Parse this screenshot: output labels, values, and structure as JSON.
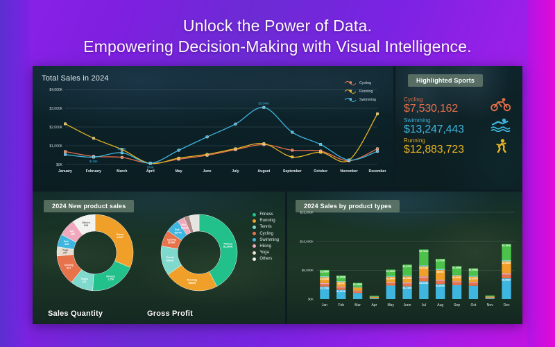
{
  "headline": {
    "line1": "Unlock the Power of Data.",
    "line2": "Empowering Decision-Making with Visual Intelligence."
  },
  "colors": {
    "cycling": "#e8724a",
    "running": "#e8b324",
    "swimming": "#3fb6e0",
    "fitness": "#22c08a",
    "tennis": "#7fd9cd",
    "hiking": "#f0a8bd",
    "yoga": "#e8ded0",
    "others": "#f2f2f0",
    "panel_bg": "#0c1c22",
    "chip_bg": "#7c927c"
  },
  "line_panel": {
    "title": "Total Sales in 2024",
    "chart_data": {
      "type": "line",
      "title": "Total Sales in 2024",
      "xlabel": "",
      "ylabel": "",
      "ylim": [
        0,
        4000
      ],
      "yticks": [
        "$0K",
        "$1,000K",
        "$2,000K",
        "$3,000K",
        "$4,000K"
      ],
      "grid": true,
      "legend_position": "right",
      "categories": [
        "January",
        "February",
        "March",
        "April",
        "May",
        "June",
        "July",
        "August",
        "September",
        "October",
        "November",
        "December"
      ],
      "series": [
        {
          "name": "Cycling",
          "color": "#e8724a",
          "values": [
            690,
            430,
            380,
            60,
            280,
            490,
            790,
            1060,
            760,
            720,
            200,
            840
          ]
        },
        {
          "name": "Running",
          "color": "#e8b324",
          "values": [
            2170,
            1400,
            800,
            60,
            340,
            540,
            840,
            1110,
            400,
            650,
            230,
            2700
          ]
        },
        {
          "name": "Swimming",
          "color": "#3fb6e0",
          "values": [
            530,
            390,
            620,
            70,
            760,
            1470,
            2160,
            3044,
            1720,
            1070,
            240,
            700
          ]
        }
      ],
      "point_labels": [
        {
          "series": "Swimming",
          "category": "February",
          "text": "$135K"
        },
        {
          "series": "Swimming",
          "category": "March",
          "text": "$650K"
        },
        {
          "series": "Swimming",
          "category": "April",
          "text": "$70K"
        },
        {
          "series": "Swimming",
          "category": "August",
          "text": "$3,044K"
        }
      ]
    }
  },
  "sports_panel": {
    "header": "Highlighted Sports",
    "items": [
      {
        "name": "Cycling",
        "value": "$7,530,162",
        "color": "#e8724a",
        "icon": "cycling-icon"
      },
      {
        "name": "Swimming",
        "value": "$13,247,443",
        "color": "#3fb6e0",
        "icon": "swimming-icon"
      },
      {
        "name": "Running",
        "value": "$12,883,723",
        "color": "#e8b324",
        "icon": "running-icon"
      }
    ]
  },
  "donut_panel": {
    "header": "2024 New product sales",
    "legend": [
      {
        "label": "Fitness",
        "color": "#22c08a"
      },
      {
        "label": "Running",
        "color": "#f0a028"
      },
      {
        "label": "Tennis",
        "color": "#7fd9cd"
      },
      {
        "label": "Cycling",
        "color": "#e8724a"
      },
      {
        "label": "Swimming",
        "color": "#3fb6e0"
      },
      {
        "label": "Hiking",
        "color": "#f0a8bd"
      },
      {
        "label": "Yoga",
        "color": "#e8ded0"
      },
      {
        "label": "Others",
        "color": "#f2f2f0"
      }
    ],
    "charts": [
      {
        "caption": "Sales Quantity",
        "chart_data": {
          "type": "pie",
          "title": "Sales Quantity",
          "labels": [
            "Running",
            "Fitness",
            "Tennis",
            "Cycling",
            "Yoga",
            "Swimming",
            "Hiking",
            "Others"
          ],
          "values": [
            2007,
            1256,
            621,
            827,
            247,
            349,
            466,
            628
          ],
          "colors": [
            "#f0a028",
            "#22c08a",
            "#7fd9cd",
            "#e8724a",
            "#e8ded0",
            "#3fb6e0",
            "#f0a8bd",
            "#f2f2f0"
          ],
          "slice_labels": [
            "Runni\n2,007",
            "Fitness\n1,256",
            "Tennis\n621",
            "Cycling\n827",
            "Yoga\n247",
            "Swi...\n349",
            "Hik...\n466",
            "Others\n628"
          ]
        }
      },
      {
        "caption": "Gross Profit",
        "chart_data": {
          "type": "pie",
          "title": "Gross Profit",
          "labels": [
            "Fitness",
            "Running",
            "Tennis",
            "Cycling",
            "Swimming",
            "Hiking",
            "Yoga",
            "Others"
          ],
          "values": [
            1809,
            980,
            536,
            298,
            247,
            131,
            96,
            180
          ],
          "colors": [
            "#22c08a",
            "#f0a028",
            "#7fd9cd",
            "#e8724a",
            "#3fb6e0",
            "#f0a8bd",
            "#b08a84",
            "#e4e4e0"
          ],
          "slice_labels": [
            "Fitness\n$1,809K",
            "Running\n$980K",
            "Tennis\n$536K",
            "Cycling\n$298K",
            "Swi...\n$247K",
            "Hiki...\n$131K",
            "",
            ""
          ]
        }
      }
    ]
  },
  "bar_panel": {
    "header": "2024 Sales by product types",
    "chart_data": {
      "type": "bar",
      "stacked": true,
      "title": "2024 Sales by product types",
      "xlabel": "",
      "ylabel": "",
      "ylim": [
        0,
        15000
      ],
      "yticks": [
        "$0K",
        "$5,000K",
        "$10,000K",
        "$15,000K"
      ],
      "grid": true,
      "categories": [
        "Jan",
        "Feb",
        "Mar",
        "Apr",
        "May",
        "June",
        "Jul",
        "Aug",
        "Sep",
        "Oct",
        "Nov",
        "Dec"
      ],
      "series": [
        {
          "name": "Swimming",
          "color": "#3fb6e0",
          "values": [
            2170,
            1610,
            1060,
            120,
            2340,
            2210,
            3060,
            2600,
            2410,
            2307,
            130,
            3594
          ]
        },
        {
          "name": "Cycling",
          "color": "#e8724a",
          "values": [
            430,
            380,
            300,
            90,
            420,
            480,
            620,
            540,
            500,
            480,
            110,
            640
          ]
        },
        {
          "name": "Hiking",
          "color": "#f0a8bd",
          "values": [
            180,
            160,
            120,
            40,
            170,
            200,
            240,
            210,
            190,
            180,
            50,
            240
          ]
        },
        {
          "name": "Running",
          "color": "#f0a028",
          "values": [
            1010,
            840,
            520,
            120,
            930,
            1030,
            1710,
            1670,
            940,
            890,
            130,
            2060
          ]
        },
        {
          "name": "Tennis",
          "color": "#7fd9cd",
          "values": [
            180,
            140,
            110,
            40,
            150,
            180,
            230,
            200,
            180,
            170,
            40,
            230
          ]
        },
        {
          "name": "Fitness",
          "color": "#4cc24a",
          "values": [
            1080,
            950,
            700,
            170,
            1100,
            1870,
            2730,
            1750,
            1490,
            1300,
            170,
            2760
          ]
        }
      ],
      "bar_labels": [
        {
          "category": "Jan",
          "parts": [
            "$1,086K",
            "$1,045K",
            "$2,170K"
          ]
        },
        {
          "category": "Feb",
          "parts": [
            "$1,250K",
            "$810K",
            "$1,610K"
          ]
        },
        {
          "category": "Mar",
          "parts": [
            "$1,086K"
          ]
        },
        {
          "category": "May",
          "parts": [
            "$1,100K",
            "$2,340K"
          ]
        },
        {
          "category": "June",
          "parts": [
            "$1,870K",
            "$1,030K",
            "$2,210K"
          ]
        },
        {
          "category": "Jul",
          "parts": [
            "$2,731K",
            "$1,712K",
            "$3,064K"
          ]
        },
        {
          "category": "Aug",
          "parts": [
            "$1,750K",
            "$667K",
            "$2,600K"
          ]
        },
        {
          "category": "Sep",
          "parts": [
            "$1,490K",
            "$2,410K"
          ]
        },
        {
          "category": "Oct",
          "parts": [
            "$1,564K",
            "$2,307K"
          ]
        },
        {
          "category": "Dec",
          "parts": [
            "$2,764K",
            "$2,060K",
            "$3,594K"
          ]
        }
      ]
    }
  }
}
